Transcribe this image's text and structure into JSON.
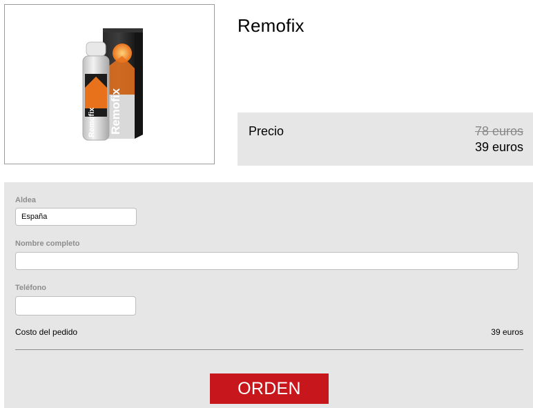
{
  "product": {
    "title": "Remofix",
    "image_label": "Remofix"
  },
  "price": {
    "label": "Precio",
    "old": "78 euros",
    "new": "39 euros"
  },
  "form": {
    "country_label": "Aldea",
    "country_value": "España",
    "name_label": "Nombre completo",
    "name_value": "",
    "phone_label": "Teléfono",
    "phone_value": "",
    "cost_label": "Costo del pedido",
    "cost_value": "39 euros",
    "submit_label": "ORDEN"
  },
  "colors": {
    "accent": "#c8171c",
    "panel_bg": "#e6e6e6",
    "product_orange": "#e8721c"
  }
}
